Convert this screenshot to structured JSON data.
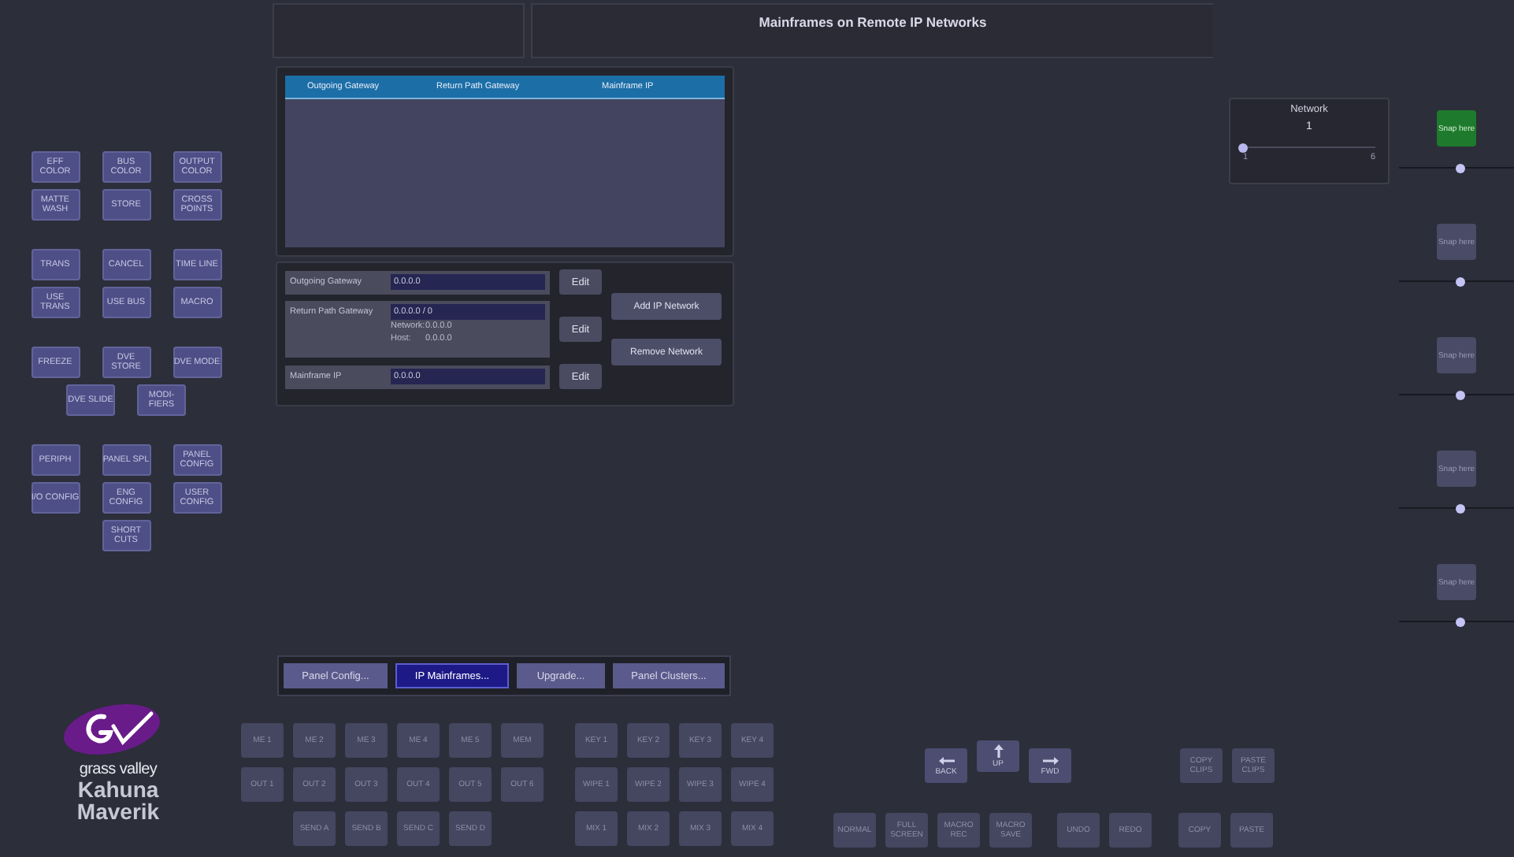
{
  "header": {
    "title": "Mainframes on Remote IP Networks"
  },
  "left_panel": {
    "groups": [
      [
        [
          "EFF COLOR",
          "BUS COLOR",
          "OUTPUT COLOR"
        ],
        [
          "MATTE WASH",
          "STORE",
          "CROSS POINTS"
        ]
      ],
      [
        [
          "TRANS",
          "CANCEL",
          "TIME LINE"
        ],
        [
          "USE TRANS",
          "USE BUS",
          "MACRO"
        ]
      ],
      [
        [
          "FREEZE",
          "DVE STORE",
          "DVE MODE"
        ],
        [
          "DVE SLIDE",
          "MODI-FIERS"
        ]
      ],
      [
        [
          "PERIPH",
          "PANEL SPL",
          "PANEL CONFIG"
        ],
        [
          "I/O CONFIG",
          "ENG CONFIG",
          "USER CONFIG"
        ],
        [
          "SHORT CUTS"
        ]
      ]
    ]
  },
  "networks_table": {
    "columns": [
      "Outgoing Gateway",
      "Return Path Gateway",
      "Mainframe IP"
    ]
  },
  "form": {
    "rows": [
      {
        "kind": "simple",
        "label": "Outgoing Gateway",
        "value": "0.0.0.0",
        "button": "Edit"
      },
      {
        "kind": "detail",
        "label": "Return Path Gateway",
        "value": "0.0.0.0 / 0",
        "details": [
          {
            "label": "Network:",
            "value": "0.0.0.0"
          },
          {
            "label": "Host:",
            "value": "0.0.0.0"
          }
        ],
        "button": "Edit"
      },
      {
        "kind": "simple",
        "label": "Mainframe IP",
        "value": "0.0.0.0",
        "button": "Edit"
      }
    ],
    "actions": [
      "Add IP Network",
      "Remove Network"
    ]
  },
  "tabs": [
    {
      "label": "Panel Config...",
      "selected": false
    },
    {
      "label": "IP Mainframes...",
      "selected": true
    },
    {
      "label": "Upgrade...",
      "selected": false
    },
    {
      "label": "Panel Clusters...",
      "selected": false
    }
  ],
  "network_selector": {
    "title": "Network",
    "value": "1",
    "level": 0,
    "min": "1",
    "max": "6"
  },
  "snap_controls": [
    {
      "label": "Snap here",
      "selected": true,
      "level": 0.53
    },
    {
      "label": "Snap here",
      "selected": false,
      "level": 0.53
    },
    {
      "label": "Snap here",
      "selected": false,
      "level": 0.53
    },
    {
      "label": "Snap here",
      "selected": false,
      "level": 0.53
    },
    {
      "label": "Snap here",
      "selected": false,
      "level": 0.53
    }
  ],
  "logo": {
    "brand": "grass valley",
    "product": [
      "Kahuna",
      "Maverik"
    ]
  },
  "keypad": {
    "groups": [
      [
        [
          "ME 1",
          "ME 2",
          "ME 3",
          "ME 4",
          "ME 5",
          "MEM"
        ],
        [
          "OUT 1",
          "OUT 2",
          "OUT 3",
          "OUT 4",
          "OUT 5",
          "OUT 6"
        ],
        [
          "SEND A",
          "SEND B",
          "SEND C",
          "SEND D"
        ]
      ],
      [
        [
          "KEY 1",
          "KEY 2",
          "KEY 3",
          "KEY 4"
        ],
        [
          "WIPE 1",
          "WIPE 2",
          "WIPE 3",
          "WIPE 4"
        ],
        [
          "MIX 1",
          "MIX 2",
          "MIX 3",
          "MIX 4"
        ]
      ]
    ]
  },
  "navigation": {
    "arrows": [
      {
        "kind": "left",
        "label": "BACK"
      },
      {
        "kind": "up",
        "label": "UP"
      },
      {
        "kind": "right",
        "label": "FWD"
      }
    ],
    "clips": [
      "COPY CLIPS",
      "PASTE CLIPS"
    ],
    "bottom_groups": [
      [
        "NORMAL",
        "FULL SCREEN",
        "MACRO REC",
        "MACRO SAVE"
      ],
      [
        "UNDO",
        "REDO"
      ],
      [
        "COPY",
        "PASTE"
      ]
    ]
  }
}
